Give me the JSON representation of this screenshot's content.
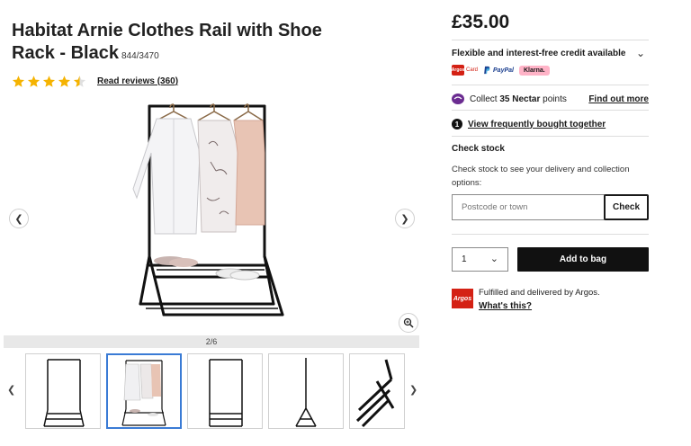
{
  "product": {
    "title": "Habitat Arnie Clothes Rail with Shoe Rack - Black",
    "sku": "844/3470",
    "rating": 4.5,
    "reviews_link": "Read reviews (360)"
  },
  "gallery": {
    "counter": "2/6",
    "thumbnails": [
      {
        "name": "front-view"
      },
      {
        "name": "styled-view"
      },
      {
        "name": "front-view-empty"
      },
      {
        "name": "side-view"
      },
      {
        "name": "detail-view"
      }
    ]
  },
  "purchase": {
    "price": "£35.00",
    "credit_title": "Flexible and interest-free credit available",
    "argos_card_box": "Argos",
    "argos_card_label": "Card",
    "paypal_label": "PayPal",
    "klarna_label": "Klarna.",
    "nectar_pre": "Collect ",
    "nectar_points": "35 Nectar",
    "nectar_post": " points",
    "nectar_link": "Find out more",
    "fbt_number": "1",
    "fbt_link": "View frequently bought together",
    "check_title": "Check stock",
    "check_desc": "Check stock to see your delivery and collection options:",
    "postcode_placeholder": "Postcode or town",
    "check_button": "Check",
    "quantity": "1",
    "add_button": "Add to bag",
    "argos_logo_text": "Argos",
    "fulfil_text": "Fulfilled and delivered by Argos.",
    "whats_this": "What's this?"
  },
  "colors": {
    "star": "#f5b301",
    "argos_red": "#d42114",
    "klarna_pink": "#ffb3c7",
    "active_thumb": "#3a7bd5",
    "nectar_purple": "#6b2c91"
  },
  "icons": [
    "star-icon",
    "chevron-left-icon",
    "chevron-right-icon",
    "zoom-icon",
    "chevron-down-icon",
    "nectar-icon",
    "paypal-icon"
  ]
}
